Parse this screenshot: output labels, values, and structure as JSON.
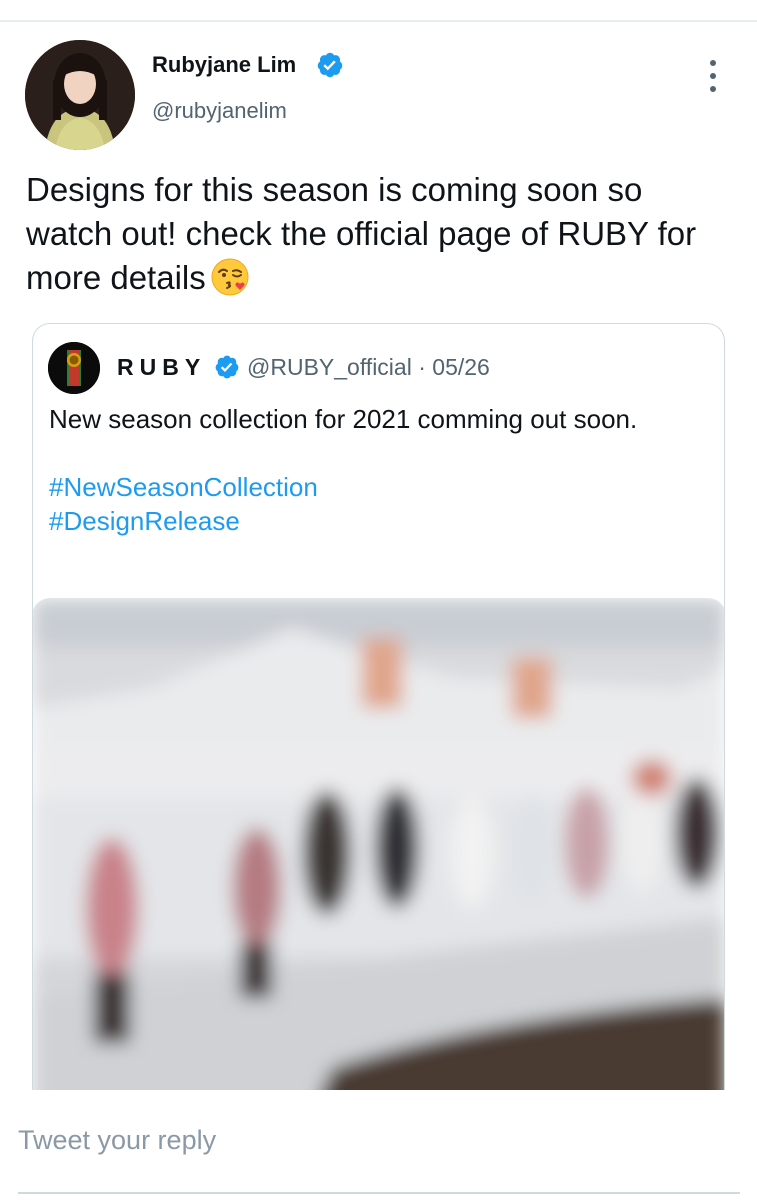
{
  "tweet": {
    "author_name": "Rubyjane Lim",
    "author_handle": "@rubyjanelim",
    "text": "Designs for this season is coming soon so watch out! check the official page of RUBY for more details",
    "emoji": "face-blowing-a-kiss-emoji",
    "menu_icon": "more-vertical-icon"
  },
  "quote": {
    "author_name": "RUBY",
    "author_handle": "@RUBY_official",
    "separator": "·",
    "date": "05/26",
    "text": "New season collection for 2021 comming out soon.",
    "hashtags": [
      "#NewSeasonCollection",
      "#DesignRelease"
    ],
    "image": "blurred-fashion-runway-photo"
  },
  "reply": {
    "placeholder": "Tweet your reply"
  },
  "colors": {
    "verified": "#1d9bf0",
    "link": "#1d9bf0",
    "secondary_text": "#536471",
    "border": "#cfd9de"
  }
}
